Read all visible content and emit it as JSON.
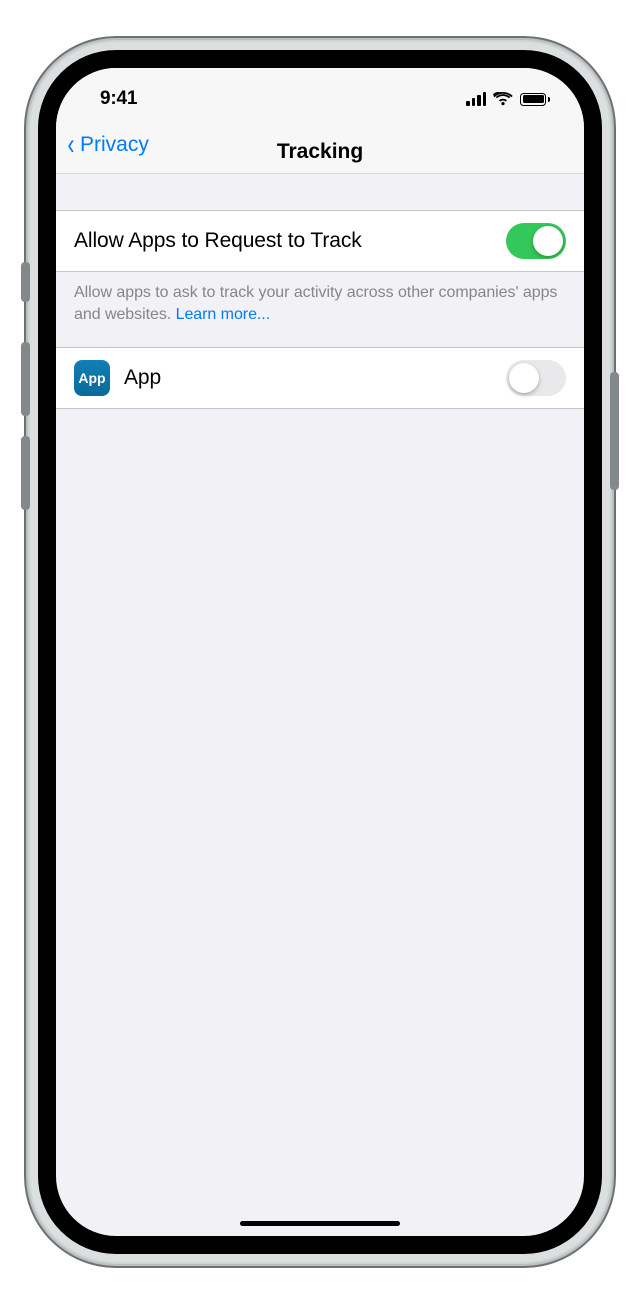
{
  "status": {
    "time": "9:41"
  },
  "nav": {
    "back_label": "Privacy",
    "title": "Tracking"
  },
  "allow_row": {
    "label": "Allow Apps to Request to Track",
    "enabled": true
  },
  "footer": {
    "text": "Allow apps to ask to track your activity across other companies' apps and websites. ",
    "learn_more": "Learn more..."
  },
  "apps": [
    {
      "name": "App",
      "icon_text": "App",
      "enabled": false
    }
  ]
}
